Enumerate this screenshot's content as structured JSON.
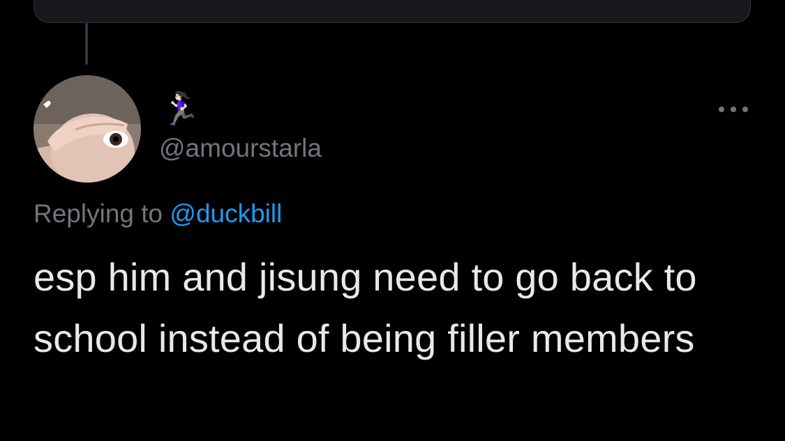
{
  "tweet": {
    "display_name": "🏃🏻‍♀️",
    "handle": "@amourstarla",
    "replying_to_label": "Replying to",
    "replying_to_handle": "@duckbill",
    "text": "esp him and jisung need to go back to school instead of being filler members"
  },
  "icons": {
    "more": "more-options-icon",
    "avatar": "profile-avatar"
  },
  "colors": {
    "background": "#000000",
    "text_primary": "#e7e9ea",
    "text_secondary": "#71767b",
    "link": "#1d9bf0",
    "thread_line": "#333639",
    "card_border": "#2f3336"
  }
}
